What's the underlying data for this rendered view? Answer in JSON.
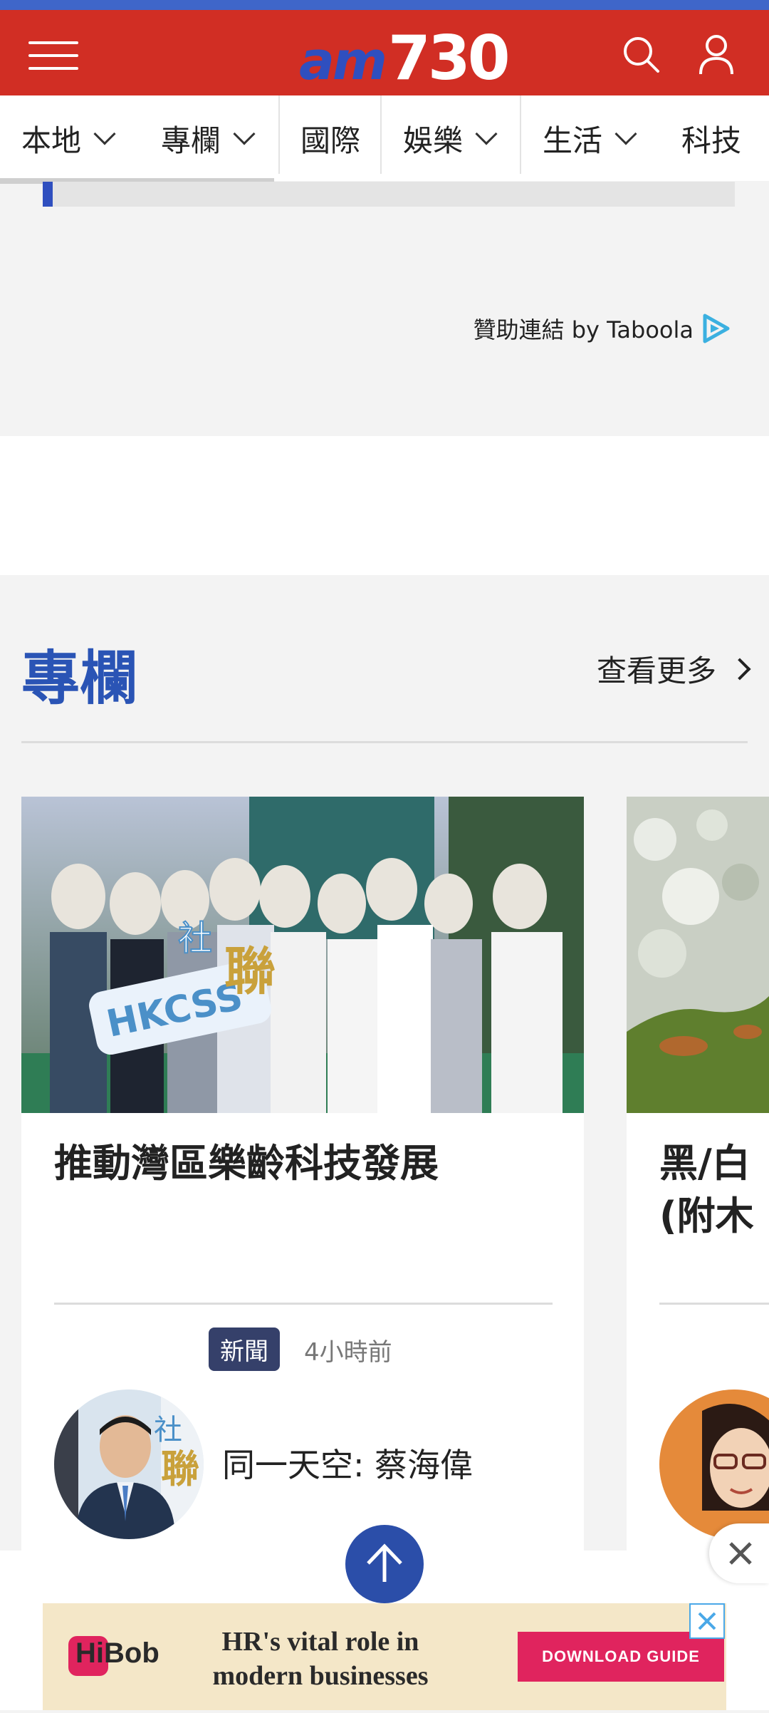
{
  "header": {
    "logo_prefix": "am",
    "logo_number": "730",
    "brand_color": "#d12e24",
    "accent_color": "#2f4fbf"
  },
  "nav": {
    "items": [
      {
        "label": "本地",
        "has_dropdown": true
      },
      {
        "label": "專欄",
        "has_dropdown": true
      },
      {
        "label": "國際",
        "has_dropdown": false
      },
      {
        "label": "娛樂",
        "has_dropdown": true
      },
      {
        "label": "生活",
        "has_dropdown": true
      },
      {
        "label": "科技",
        "has_dropdown": false
      }
    ]
  },
  "sponsor": {
    "text": "贊助連結 by Taboola"
  },
  "section": {
    "title": "專欄",
    "more_label": "查看更多"
  },
  "cards": [
    {
      "title": "推動灣區樂齡科技發展",
      "category": "新聞",
      "time": "4小時前",
      "author": "同一天空: 蔡海偉",
      "image_text": "HKCSS 社聯",
      "avatar_text": "社聯"
    },
    {
      "title_line1": "黑/白",
      "title_line2": "(附木"
    }
  ],
  "bottom_ad": {
    "brand": "HiBob",
    "headline_line1": "HR's vital role in",
    "headline_line2": "modern businesses",
    "cta": "DOWNLOAD GUIDE"
  }
}
